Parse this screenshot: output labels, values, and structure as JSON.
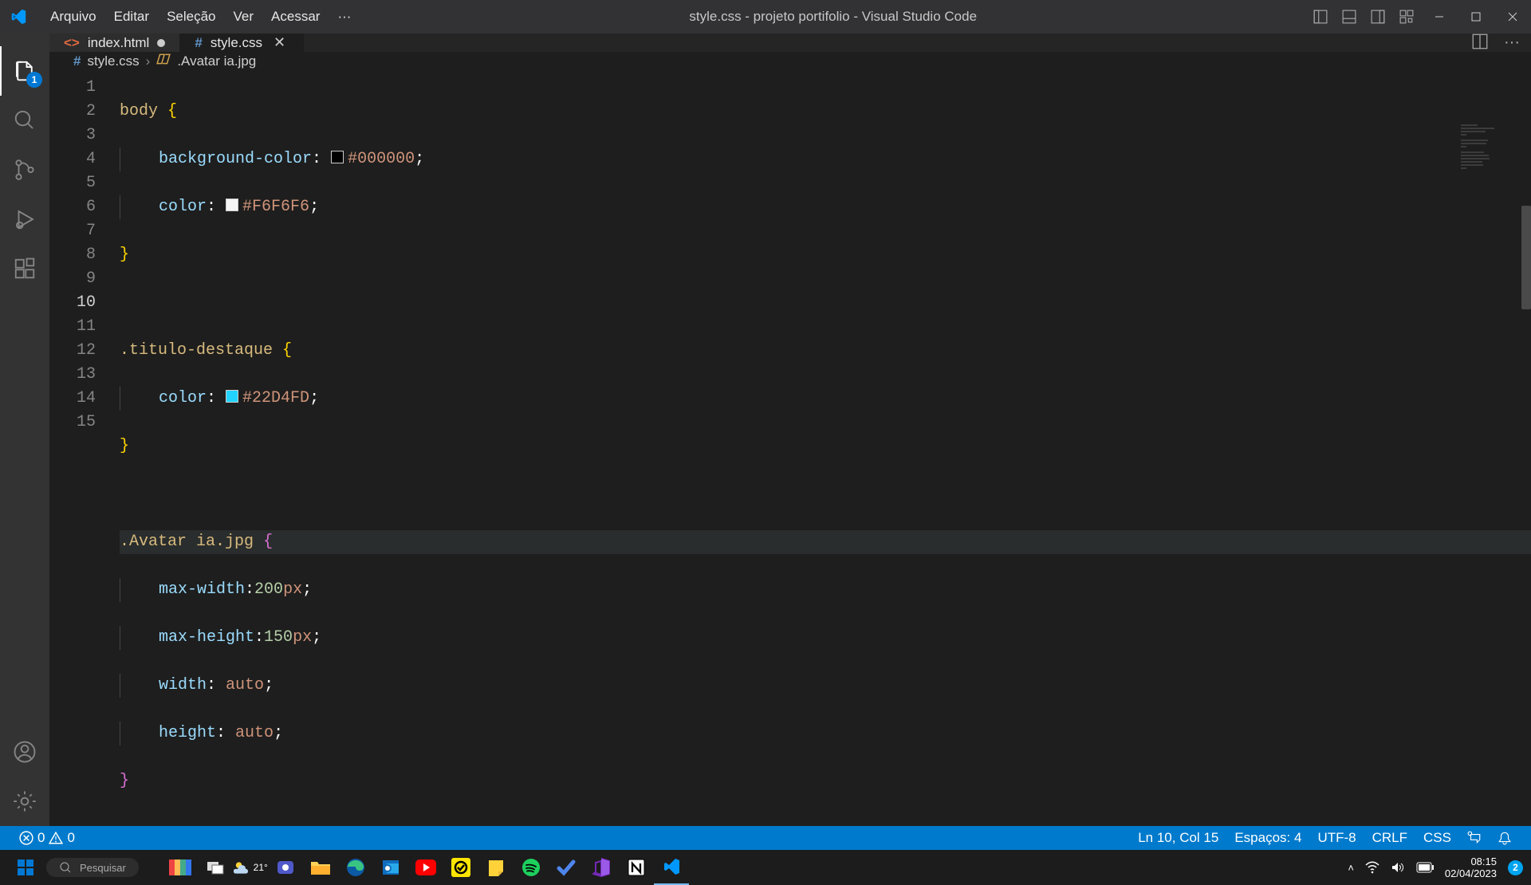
{
  "titlebar": {
    "menus": [
      "Arquivo",
      "Editar",
      "Seleção",
      "Ver",
      "Acessar",
      "···"
    ],
    "title": "style.css - projeto portifolio - Visual Studio Code"
  },
  "activity": {
    "explorer_badge": "1"
  },
  "tabs": {
    "items": [
      {
        "icon": "<>",
        "filename": "index.html",
        "dirty": true,
        "active": false,
        "kind": "html"
      },
      {
        "icon": "#",
        "filename": "style.css",
        "dirty": false,
        "active": true,
        "kind": "css"
      }
    ]
  },
  "breadcrumb": {
    "icon1": "#",
    "seg1": "style.css",
    "sep": "›",
    "seg2": ".Avatar ia.jpg"
  },
  "editor": {
    "line_numbers": [
      "1",
      "2",
      "3",
      "4",
      "5",
      "6",
      "7",
      "8",
      "9",
      "10",
      "11",
      "12",
      "13",
      "14",
      "15"
    ],
    "lines": {
      "l1_body": "body",
      "l1_ob": "{",
      "l2_prop": "background-color",
      "l2_colon": ":",
      "l2_swatch": "#000000",
      "l2_val": "#000000",
      "l2_semi": ";",
      "l3_prop": "color",
      "l3_colon": ":",
      "l3_swatch": "#F6F6F6",
      "l3_val": "#F6F6F6",
      "l3_semi": ";",
      "l4_cb": "}",
      "l6_sel": ".titulo-destaque",
      "l6_ob": "{",
      "l7_prop": "color",
      "l7_colon": ":",
      "l7_swatch": "#22D4FD",
      "l7_val": "#22D4FD",
      "l7_semi": ";",
      "l8_cb": "}",
      "l10_sel": ".Avatar",
      "l10_id": " ia",
      "l10_jpg": ".jpg",
      "l10_ob": "{",
      "l11_prop": "max-width",
      "l11_colon": ":",
      "l11_num": "200",
      "l11_unit": "px",
      "l11_semi": ";",
      "l12_prop": "max-height",
      "l12_colon": ":",
      "l12_num": "150",
      "l12_unit": "px",
      "l12_semi": ";",
      "l13_prop": "width",
      "l13_colon": ":",
      "l13_val": "auto",
      "l13_semi": ";",
      "l14_prop": "height",
      "l14_colon": ":",
      "l14_val": "auto",
      "l14_semi": ";",
      "l15_cb": "}"
    }
  },
  "status": {
    "errors": "0",
    "warnings": "0",
    "position": "Ln 10, Col 15",
    "indent": "Espaços: 4",
    "encoding": "UTF-8",
    "eol": "CRLF",
    "language": "CSS"
  },
  "taskbar": {
    "search_placeholder": "Pesquisar",
    "weather": "21°",
    "time": "08:15",
    "date": "02/04/2023",
    "tray_badge": "2"
  },
  "colors": {
    "accent": "#007acc"
  }
}
